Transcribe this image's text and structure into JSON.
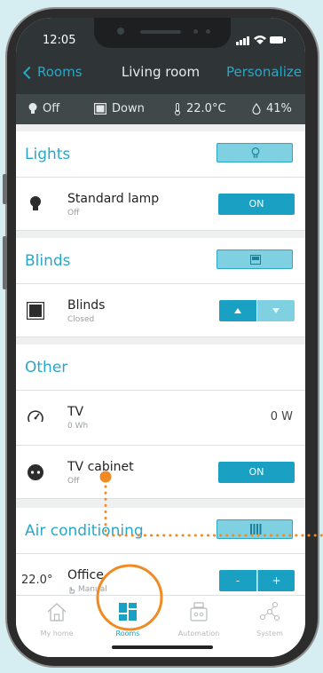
{
  "status_bar": {
    "time": "12:05"
  },
  "nav": {
    "back_label": "Rooms",
    "title": "Living room",
    "action_label": "Personalize"
  },
  "info": {
    "lights": "Off",
    "blinds": "Down",
    "temperature": "22.0°C",
    "humidity": "41%"
  },
  "sections": {
    "lights": {
      "title": "Lights"
    },
    "blinds": {
      "title": "Blinds"
    },
    "other": {
      "title": "Other"
    },
    "air": {
      "title": "Air conditioning"
    }
  },
  "devices": {
    "standard_lamp": {
      "name": "Standard lamp",
      "status": "Off",
      "button": "ON"
    },
    "blinds": {
      "name": "Blinds",
      "status": "Closed"
    },
    "tv": {
      "name": "TV",
      "status": "0 Wh",
      "value": "0 W"
    },
    "tv_cabinet": {
      "name": "TV cabinet",
      "status": "Off",
      "button": "ON"
    },
    "office": {
      "name": "Office",
      "status": "Manual",
      "setpoint": "22.0°",
      "minus": "-",
      "plus": "+"
    }
  },
  "tabs": [
    "My home",
    "Rooms",
    "Automation",
    "System"
  ],
  "colors": {
    "accent": "#2aa6c7",
    "highlight": "#f08a24",
    "dark": "#2f3536"
  }
}
